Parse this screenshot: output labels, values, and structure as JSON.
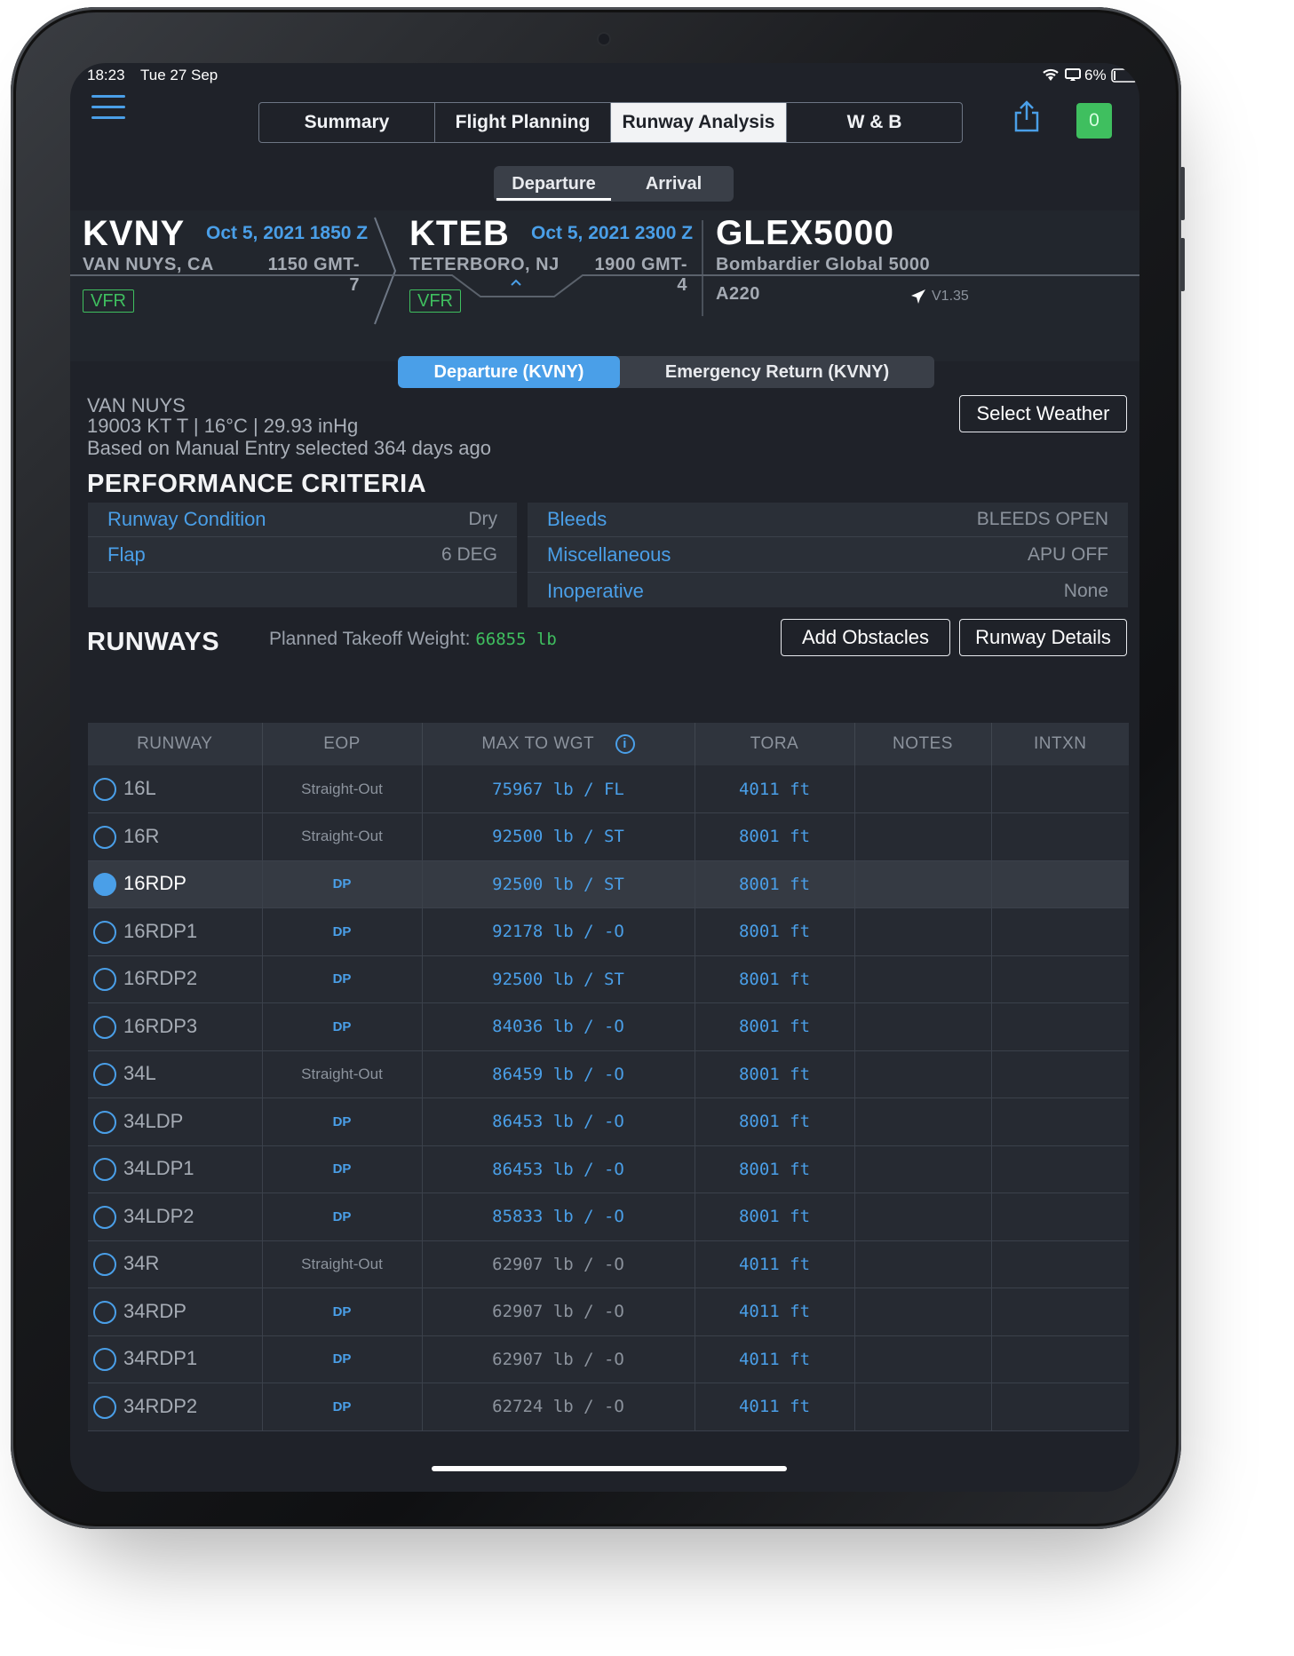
{
  "status_bar": {
    "time": "18:23",
    "date": "Tue 27 Sep",
    "battery": "6%"
  },
  "nav": {
    "tabs": [
      {
        "label": "Summary",
        "active": false
      },
      {
        "label": "Flight Planning",
        "active": false
      },
      {
        "label": "Runway Analysis",
        "active": true
      },
      {
        "label": "W & B",
        "active": false
      }
    ],
    "badge_count": "0",
    "sub_tabs": [
      {
        "label": "Departure",
        "active": true
      },
      {
        "label": "Arrival",
        "active": false
      }
    ]
  },
  "flight": {
    "departure": {
      "icao": "KVNY",
      "datetime": "Oct 5, 2021 1850 Z",
      "city": "VAN NUYS, CA",
      "local": "1150 GMT-7",
      "flight_rules": "VFR"
    },
    "arrival": {
      "icao": "KTEB",
      "datetime": "Oct 5, 2021 2300 Z",
      "city": "TETERBORO, NJ",
      "local": "1900 GMT-4",
      "flight_rules": "VFR"
    },
    "aircraft": {
      "id": "GLEX5000",
      "type": "Bombardier Global 5000",
      "code": "A220",
      "version": "V1.35"
    }
  },
  "analysis_tabs": [
    {
      "label": "Departure (KVNY)",
      "active": true
    },
    {
      "label": "Emergency Return (KVNY)",
      "active": false
    }
  ],
  "weather": {
    "station": "VAN NUYS",
    "conditions": "19003 KT T | 16°C | 29.93 inHg",
    "source": "Based on Manual Entry selected 364 days ago",
    "select_button": "Select Weather"
  },
  "performance": {
    "title": "PERFORMANCE CRITERIA",
    "left": [
      {
        "label": "Runway Condition",
        "value": "Dry"
      },
      {
        "label": "Flap",
        "value": "6 DEG"
      }
    ],
    "right": [
      {
        "label": "Bleeds",
        "value": "BLEEDS OPEN"
      },
      {
        "label": "Miscellaneous",
        "value": "APU OFF"
      },
      {
        "label": "Inoperative",
        "value": "None"
      }
    ]
  },
  "runways": {
    "title": "RUNWAYS",
    "ptw_label": "Planned Takeoff Weight:",
    "ptw_value": "66855 lb",
    "add_obstacles": "Add Obstacles",
    "runway_details": "Runway Details",
    "columns": [
      "RUNWAY",
      "EOP",
      "MAX TO WGT",
      "TORA",
      "NOTES",
      "INTXN"
    ],
    "rows": [
      {
        "runway": "16L",
        "eop": "Straight-Out",
        "wgt": "75967 lb / FL",
        "tora": "4011 ft",
        "selected": false,
        "ok": true
      },
      {
        "runway": "16R",
        "eop": "Straight-Out",
        "wgt": "92500 lb / ST",
        "tora": "8001 ft",
        "selected": false,
        "ok": true
      },
      {
        "runway": "16RDP",
        "eop": "DP",
        "wgt": "92500 lb / ST",
        "tora": "8001 ft",
        "selected": true,
        "ok": true
      },
      {
        "runway": "16RDP1",
        "eop": "DP",
        "wgt": "92178 lb / -O",
        "tora": "8001 ft",
        "selected": false,
        "ok": true
      },
      {
        "runway": "16RDP2",
        "eop": "DP",
        "wgt": "92500 lb / ST",
        "tora": "8001 ft",
        "selected": false,
        "ok": true
      },
      {
        "runway": "16RDP3",
        "eop": "DP",
        "wgt": "84036 lb / -O",
        "tora": "8001 ft",
        "selected": false,
        "ok": true
      },
      {
        "runway": "34L",
        "eop": "Straight-Out",
        "wgt": "86459 lb / -O",
        "tora": "8001 ft",
        "selected": false,
        "ok": true
      },
      {
        "runway": "34LDP",
        "eop": "DP",
        "wgt": "86453 lb / -O",
        "tora": "8001 ft",
        "selected": false,
        "ok": true
      },
      {
        "runway": "34LDP1",
        "eop": "DP",
        "wgt": "86453 lb / -O",
        "tora": "8001 ft",
        "selected": false,
        "ok": true
      },
      {
        "runway": "34LDP2",
        "eop": "DP",
        "wgt": "85833 lb / -O",
        "tora": "8001 ft",
        "selected": false,
        "ok": true
      },
      {
        "runway": "34R",
        "eop": "Straight-Out",
        "wgt": "62907 lb / -O",
        "tora": "4011 ft",
        "selected": false,
        "ok": false
      },
      {
        "runway": "34RDP",
        "eop": "DP",
        "wgt": "62907 lb / -O",
        "tora": "4011 ft",
        "selected": false,
        "ok": false
      },
      {
        "runway": "34RDP1",
        "eop": "DP",
        "wgt": "62907 lb / -O",
        "tora": "4011 ft",
        "selected": false,
        "ok": false
      },
      {
        "runway": "34RDP2",
        "eop": "DP",
        "wgt": "62724 lb / -O",
        "tora": "4011 ft",
        "selected": false,
        "ok": false
      }
    ]
  },
  "colors": {
    "accent": "#4a9fe8",
    "success": "#3fbf5f",
    "background": "#1f2229"
  }
}
